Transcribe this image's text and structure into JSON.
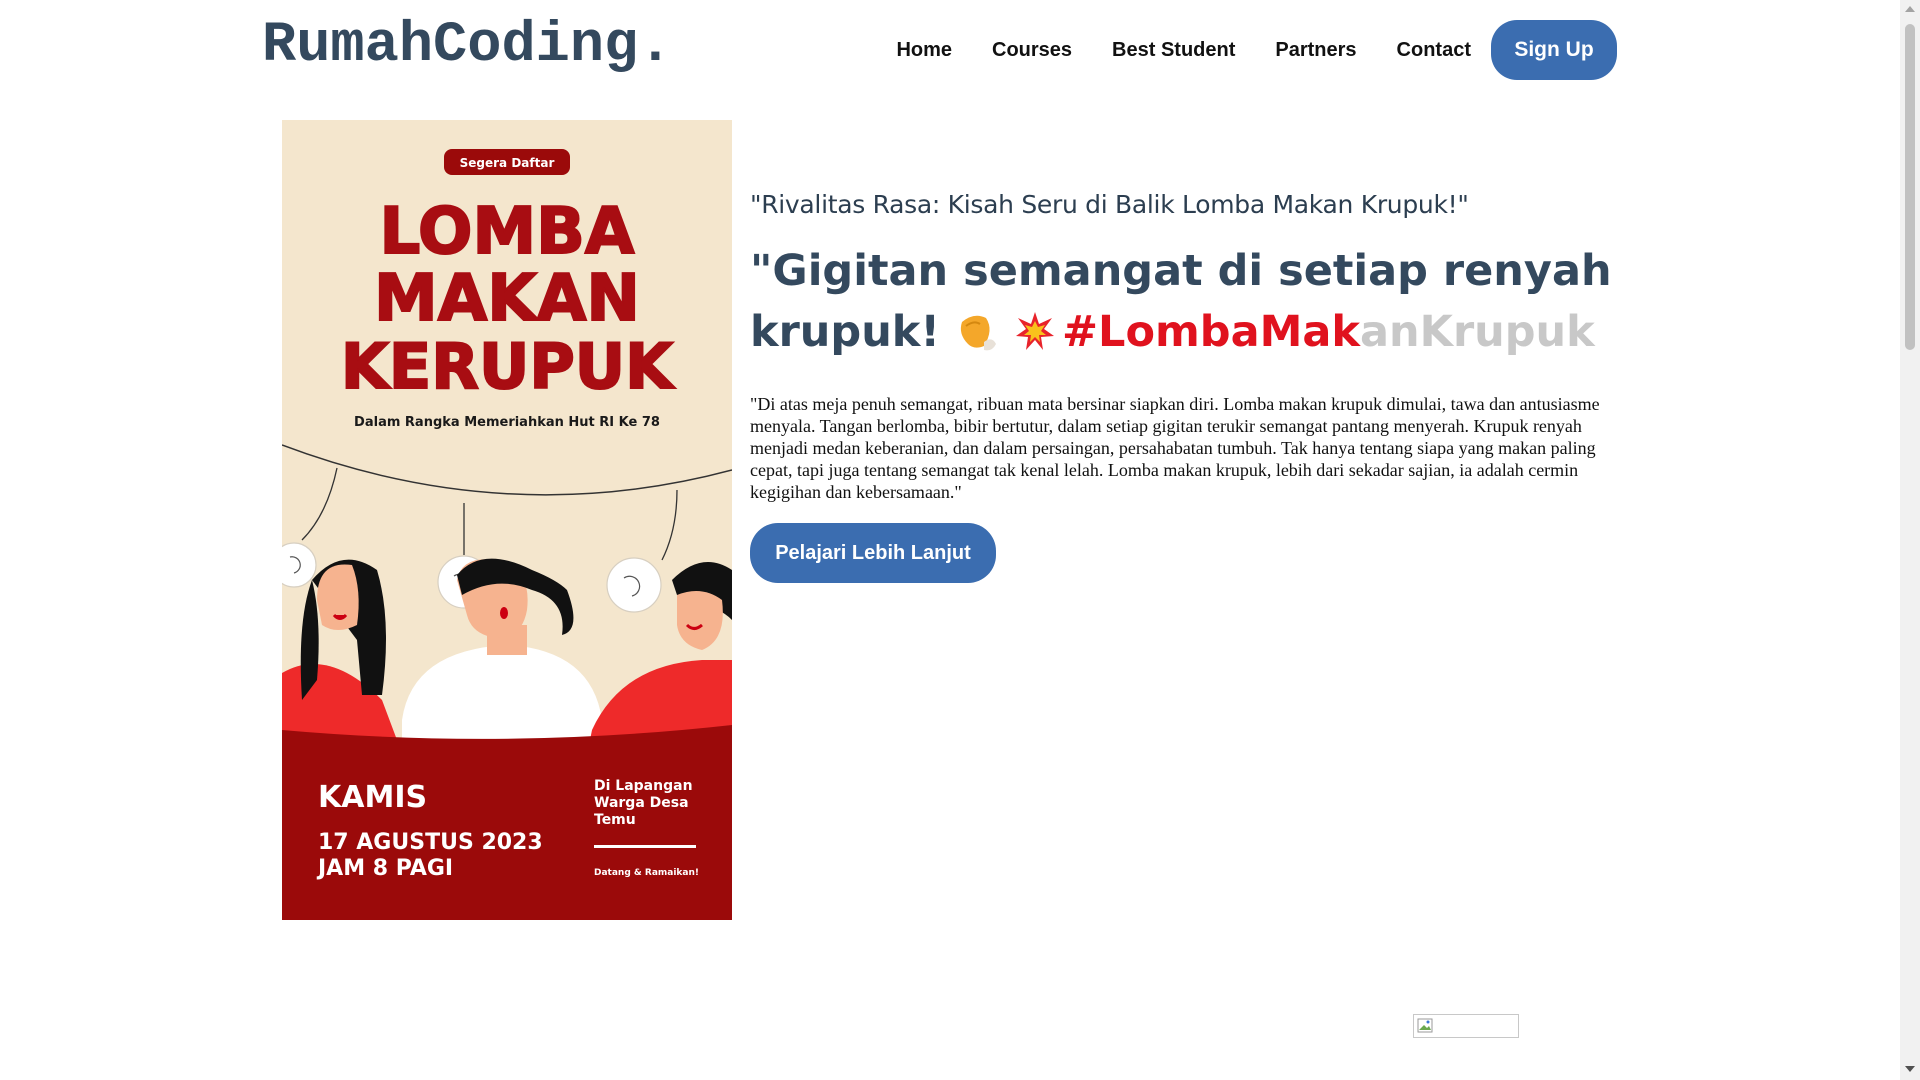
{
  "header": {
    "logo": "RumahCoding.",
    "nav": [
      "Home",
      "Courses",
      "Best Student",
      "Partners",
      "Contact"
    ],
    "signup_label": "Sign Up"
  },
  "poster": {
    "badge": "Segera Daftar",
    "title_line1": "LOMBA",
    "title_line2": "MAKAN",
    "title_line3": "KERUPUK",
    "subtitle": "Dalam Rangka Memeriahkan Hut RI Ke 78",
    "day": "KAMIS",
    "date": "17 AGUSTUS 2023",
    "time": "JAM 8 PAGI",
    "location_line1": "Di Lapangan",
    "location_line2": "Warga Desa",
    "location_line3": "Temu",
    "tagline": "Datang & Ramaikan!"
  },
  "content": {
    "subtitle": "\"Rivalitas Rasa: Kisah Seru di Balik Lomba Makan Krupuk!\"",
    "headline_part1": "\"Gigitan semangat di setiap renyah krupuk!",
    "hashtag_red": "#LombaMak",
    "hashtag_grey": "anKrupuk",
    "body": "\"Di atas meja penuh semangat, ribuan mata bersinar siapkan diri. Lomba makan krupuk dimulai, tawa dan antusiasme menyala. Tangan berlomba, bibir bertutur, dalam setiap gigitan terukir semangat pantang menyerah. Krupuk renyah menjadi medan keberanian, dan dalam persaingan, persahabatan tumbuh. Tak hanya tentang siapa yang makan paling cepat, tapi juga tentang semangat tak kenal lelah. Lomba makan krupuk, lebih dari sekadar sajian, ia adalah cermin kegigihan dan kebersamaan.\"",
    "cta_label": "Pelajari Lebih Lanjut"
  },
  "colors": {
    "brand_blue": "#3b6db0",
    "heading": "#34495e",
    "poster_red": "#9b0a0a",
    "poster_cream": "#f4e6cd",
    "hashtag_red": "#e0121e"
  }
}
